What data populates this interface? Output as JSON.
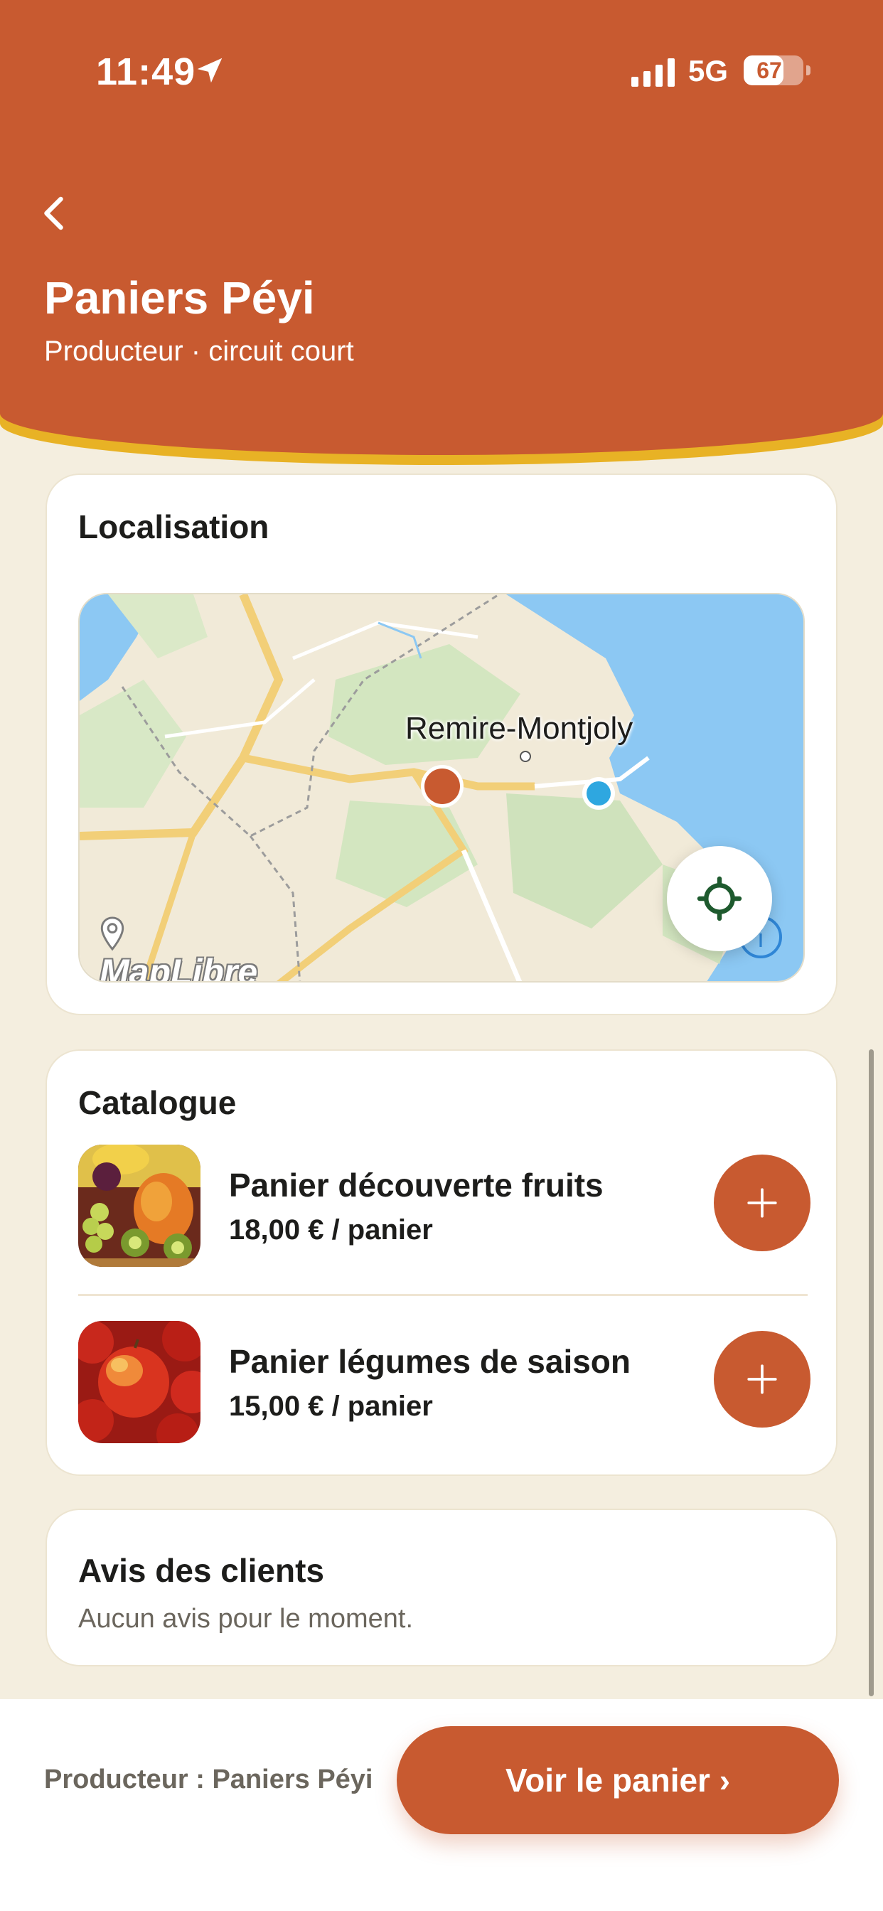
{
  "status_bar": {
    "time": "11:49",
    "network": "5G",
    "battery": "67",
    "battery_level": 0.67
  },
  "header": {
    "back_icon": "chevron-left-icon",
    "title": "Paniers Péyi",
    "subtitle": "Producteur · circuit court"
  },
  "location": {
    "title": "Localisation",
    "map_place": "Remire-Montjoly",
    "attribution": "MapLibre",
    "locate_icon": "crosshair-icon"
  },
  "catalogue": {
    "title": "Catalogue",
    "items": [
      {
        "name": "Panier découverte fruits",
        "price": "18,00 € / panier",
        "image": "fruits-photo"
      },
      {
        "name": "Panier légumes de saison",
        "price": "15,00 € / panier",
        "image": "apples-photo"
      }
    ],
    "add_icon": "plus-icon"
  },
  "reviews": {
    "title": "Avis des clients",
    "empty_text": "Aucun avis pour le moment."
  },
  "footer": {
    "producer_label": "Producteur : Paniers Péyi",
    "cart_button": "Voir le panier ›"
  },
  "colors": {
    "brand": "#c85a30",
    "accent": "#e8b225",
    "background": "#f4eedf",
    "locate_icon": "#1e5a2e"
  }
}
